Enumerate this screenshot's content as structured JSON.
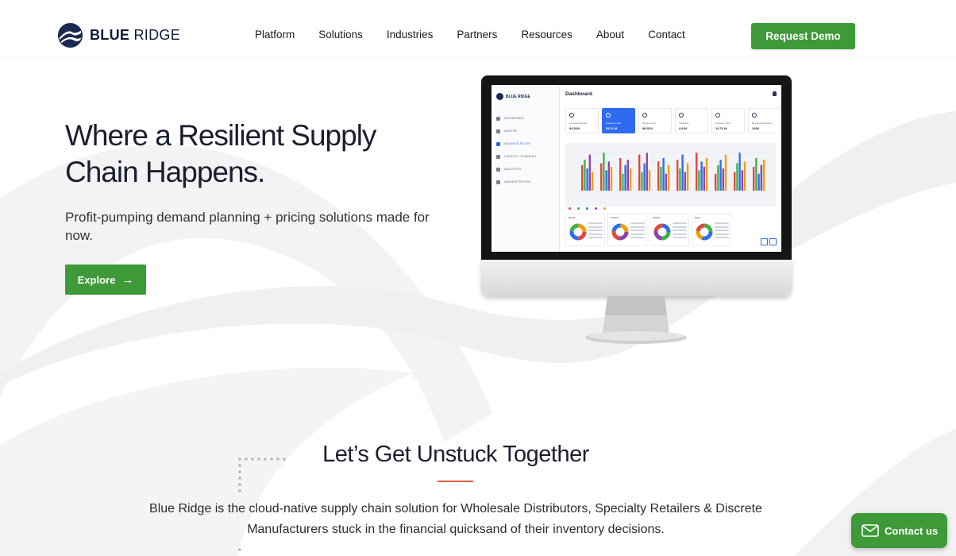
{
  "brand": {
    "name_bold": "BLUE",
    "name_rest": " RIDGE"
  },
  "nav": {
    "items": [
      {
        "label": "Platform"
      },
      {
        "label": "Solutions"
      },
      {
        "label": "Industries"
      },
      {
        "label": "Partners"
      },
      {
        "label": "Resources"
      },
      {
        "label": "About"
      },
      {
        "label": "Contact"
      }
    ],
    "cta_label": "Request Demo"
  },
  "hero": {
    "title": "Where a Resilient Supply Chain Happens.",
    "subtitle": "Profit-pumping demand planning + pricing solutions made for now.",
    "explore_label": "Explore"
  },
  "dashboard": {
    "title": "Dashboard",
    "logo_text": "BLUE RIDGE",
    "menu": [
      {
        "label": "DASHBOARD",
        "active": false
      },
      {
        "label": "MASTER",
        "active": false
      },
      {
        "label": "ADVANCE FILTER",
        "active": true
      },
      {
        "label": "CAPACITY PLANNING",
        "active": false
      },
      {
        "label": "ANALYTICS",
        "active": false
      },
      {
        "label": "ADMINISTRATION",
        "active": false
      }
    ],
    "kpis": [
      {
        "label": "Forecast Accuracy",
        "value": "94.54%"
      },
      {
        "label": "Inventory Level",
        "value": "35.11 M"
      },
      {
        "label": "Service Level",
        "value": "98.32%"
      },
      {
        "label": "Stockouts",
        "value": "4.8 M"
      },
      {
        "label": "Inventory Turns",
        "value": "14.76 M"
      },
      {
        "label": "Demand Exceptions",
        "value": "1000"
      }
    ],
    "donut_labels": [
      "Brand",
      "Product",
      "Weight",
      "Store"
    ]
  },
  "section": {
    "title": "Let’s Get Unstuck Together",
    "body": "Blue Ridge is the cloud-native supply chain solution for Wholesale Distributors, Specialty Retailers & Discrete Manufacturers stuck in the financial quicksand of their inventory decisions."
  },
  "contact": {
    "label": "Contact us"
  },
  "colors": {
    "accent_green": "#3e9a39",
    "brand_navy": "#101a3a",
    "underline_red": "#e35b3a",
    "dash_blue": "#2f6bf0"
  }
}
